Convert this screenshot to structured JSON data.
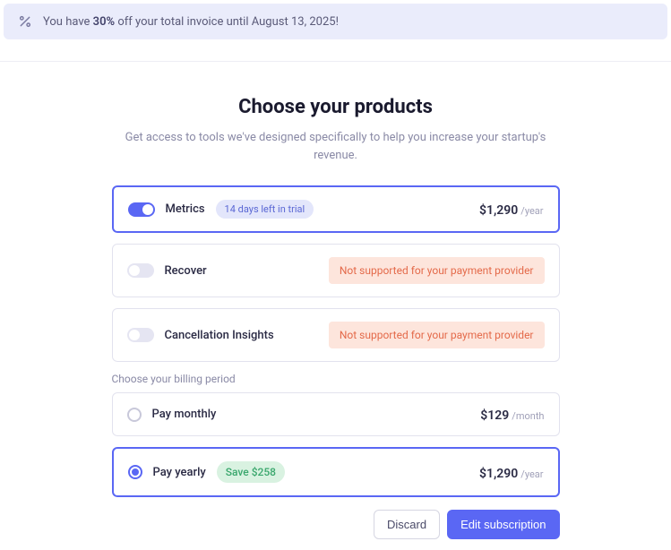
{
  "banner": {
    "text_before": "You have ",
    "discount": "30%",
    "text_after": " off your total invoice until August 13, 2025!"
  },
  "heading": "Choose your products",
  "subtitle": "Get access to tools we've designed specifically to help you increase your startup's revenue.",
  "products": [
    {
      "name": "Metrics",
      "trial_badge": "14 days left in trial",
      "price": "$1,290",
      "period": "/year",
      "active": true
    },
    {
      "name": "Recover",
      "warn": "Not supported for your payment provider",
      "active": false
    },
    {
      "name": "Cancellation Insights",
      "warn": "Not supported for your payment provider",
      "active": false
    }
  ],
  "billing_label": "Choose your billing period",
  "billing_options": [
    {
      "label": "Pay monthly",
      "price": "$129",
      "period": "/month",
      "selected": false
    },
    {
      "label": "Pay yearly",
      "save": "Save $258",
      "price": "$1,290",
      "period": "/year",
      "selected": true
    }
  ],
  "footer": {
    "discard": "Discard",
    "edit": "Edit subscription"
  }
}
